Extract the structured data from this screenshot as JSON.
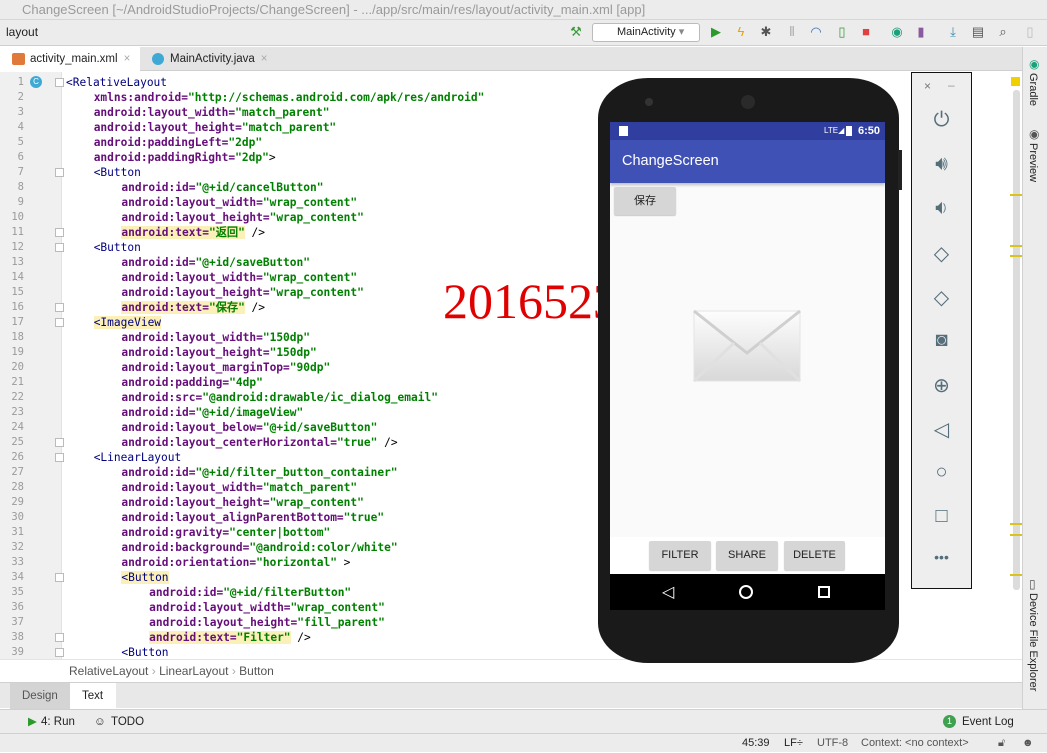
{
  "window": {
    "title": "ChangeScreen [~/AndroidStudioProjects/ChangeScreen] - .../app/src/main/res/layout/activity_main.xml [app]"
  },
  "toolbar": {
    "breadcrumb": "layout",
    "run_config": "MainActivity"
  },
  "tabs": [
    {
      "label": "activity_main.xml",
      "active": true
    },
    {
      "label": "MainActivity.java",
      "active": false
    }
  ],
  "editor": {
    "lines": [
      {
        "t": "<RelativeLayout",
        "i": 0
      },
      {
        "t": "xmlns:android=\"http://schemas.android.com/apk/res/android\"",
        "i": 1
      },
      {
        "t": "android:layout_width=\"match_parent\"",
        "i": 1
      },
      {
        "t": "android:layout_height=\"match_parent\"",
        "i": 1
      },
      {
        "t": "android:paddingLeft=\"2dp\"",
        "i": 1
      },
      {
        "t": "android:paddingRight=\"2dp\">",
        "i": 1
      },
      {
        "t": "<Button",
        "i": 1
      },
      {
        "t": "android:id=\"@+id/cancelButton\"",
        "i": 2
      },
      {
        "t": "android:layout_width=\"wrap_content\"",
        "i": 2
      },
      {
        "t": "android:layout_height=\"wrap_content\"",
        "i": 2
      },
      {
        "t": "android:text=\"返回\" />",
        "i": 2,
        "hl": true
      },
      {
        "t": "<Button",
        "i": 1
      },
      {
        "t": "android:id=\"@+id/saveButton\"",
        "i": 2
      },
      {
        "t": "android:layout_width=\"wrap_content\"",
        "i": 2
      },
      {
        "t": "android:layout_height=\"wrap_content\"",
        "i": 2
      },
      {
        "t": "android:text=\"保存\" />",
        "i": 2,
        "hl": true
      },
      {
        "t": "<ImageView",
        "i": 1,
        "hl": true
      },
      {
        "t": "android:layout_width=\"150dp\"",
        "i": 2
      },
      {
        "t": "android:layout_height=\"150dp\"",
        "i": 2
      },
      {
        "t": "android:layout_marginTop=\"90dp\"",
        "i": 2
      },
      {
        "t": "android:padding=\"4dp\"",
        "i": 2
      },
      {
        "t": "android:src=\"@android:drawable/ic_dialog_email\"",
        "i": 2
      },
      {
        "t": "android:id=\"@+id/imageView\"",
        "i": 2
      },
      {
        "t": "android:layout_below=\"@+id/saveButton\"",
        "i": 2
      },
      {
        "t": "android:layout_centerHorizontal=\"true\" />",
        "i": 2
      },
      {
        "t": "<LinearLayout",
        "i": 1
      },
      {
        "t": "android:id=\"@+id/filter_button_container\"",
        "i": 2
      },
      {
        "t": "android:layout_width=\"match_parent\"",
        "i": 2
      },
      {
        "t": "android:layout_height=\"wrap_content\"",
        "i": 2
      },
      {
        "t": "android:layout_alignParentBottom=\"true\"",
        "i": 2
      },
      {
        "t": "android:gravity=\"center|bottom\"",
        "i": 2
      },
      {
        "t": "android:background=\"@android:color/white\"",
        "i": 2
      },
      {
        "t": "android:orientation=\"horizontal\" >",
        "i": 2
      },
      {
        "t": "<Button",
        "i": 2,
        "hl": true
      },
      {
        "t": "android:id=\"@+id/filterButton\"",
        "i": 3
      },
      {
        "t": "android:layout_width=\"wrap_content\"",
        "i": 3
      },
      {
        "t": "android:layout_height=\"fill_parent\"",
        "i": 3
      },
      {
        "t": "android:text=\"Filter\" />",
        "i": 3,
        "hl": true
      },
      {
        "t": "<Button",
        "i": 2
      }
    ]
  },
  "breadcrumb": [
    "RelativeLayout",
    "LinearLayout",
    "Button"
  ],
  "design_tabs": [
    "Design",
    "Text"
  ],
  "overlay_text": "20165233",
  "phone": {
    "time": "6:50",
    "app_title": "ChangeScreen",
    "save_button": "保存",
    "buttons": [
      "FILTER",
      "SHARE",
      "DELETE"
    ]
  },
  "tool_windows": {
    "run": "4: Run",
    "todo": "TODO",
    "event_log": "Event Log",
    "event_count": "1"
  },
  "right_strip": {
    "gradle": "Gradle",
    "preview": "Preview",
    "device_explorer": "Device File Explorer"
  },
  "status": {
    "position": "45:39",
    "line_sep": "LF÷",
    "encoding": "UTF-8",
    "context": "Context: <no context>"
  },
  "colors": {
    "primary": "#3f51b5",
    "primary_dark": "#303f9f",
    "overlay": "#e00000"
  }
}
